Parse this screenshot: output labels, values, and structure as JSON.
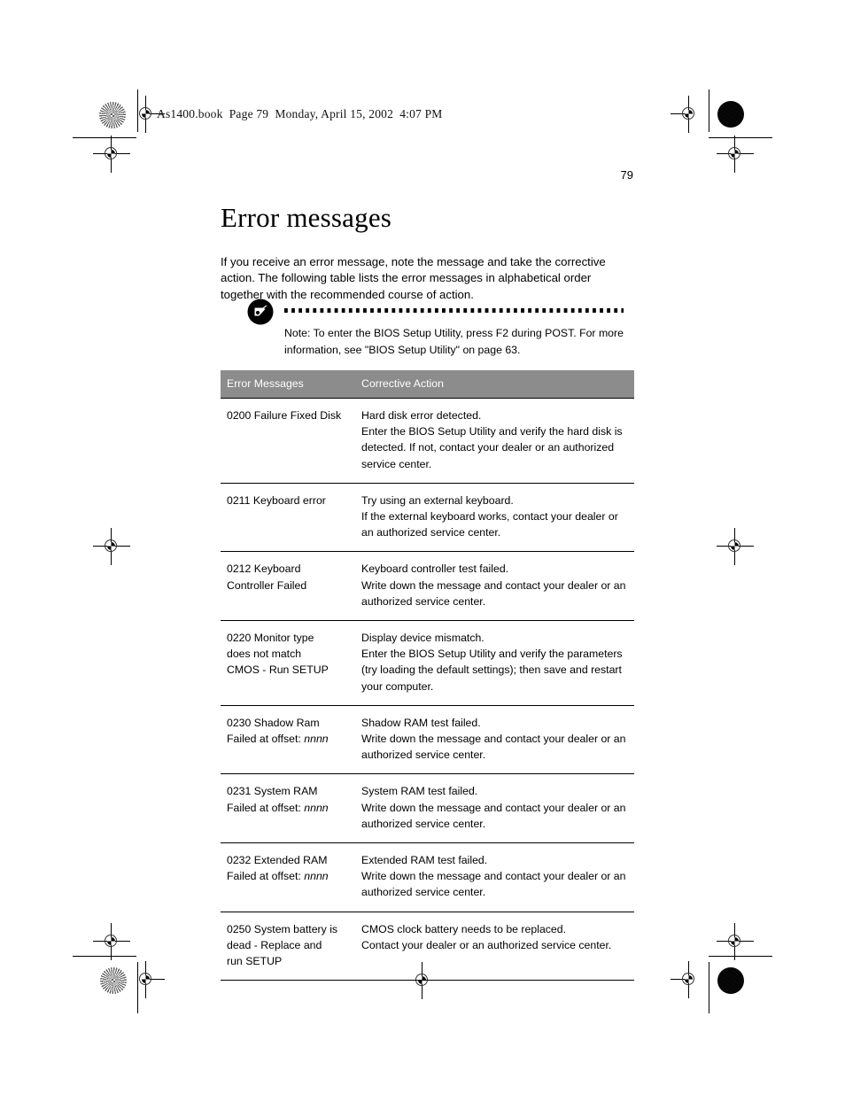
{
  "print_slug": "As1400.book  Page 79  Monday, April 15, 2002  4:07 PM",
  "page_number": "79",
  "page_title": "Error messages",
  "intro": "If you receive an error message, note the message and take the corrective action.  The following table lists the error messages in alphabetical order together with the recommended course of action.",
  "note": {
    "icon": "note-pencil-icon",
    "text": "Note:  To enter the BIOS Setup Utility, press F2 during POST.  For more information, see \"BIOS Setup Utility\" on page 63."
  },
  "table": {
    "headers": [
      "Error Messages",
      "Corrective Action"
    ],
    "rows": [
      {
        "message": "0200 Failure Fixed Disk",
        "action": "Hard disk error detected.\nEnter the BIOS Setup Utility and verify the hard disk is detected.  If not, contact your dealer or an authorized service center."
      },
      {
        "message": "0211 Keyboard error",
        "action": "Try using an external keyboard.\nIf the external keyboard works, contact your dealer or an authorized service center."
      },
      {
        "message": "0212 Keyboard\nController Failed",
        "action": "Keyboard controller test failed.\nWrite down the message and contact your dealer or an authorized service center."
      },
      {
        "message": "0220 Monitor type\ndoes not match\nCMOS - Run SETUP",
        "action": "Display device mismatch.\nEnter the BIOS Setup Utility and verify the parameters (try loading the default settings); then save and restart your computer."
      },
      {
        "message": "0230 Shadow Ram\nFailed at offset: nnnn",
        "action": "Shadow RAM test failed.\nWrite down the message and contact your dealer or an authorized service center."
      },
      {
        "message": "0231 System RAM\nFailed at offset: nnnn",
        "action": "System RAM test failed.\nWrite down the message and contact your dealer or an authorized service center."
      },
      {
        "message": "0232 Extended RAM\nFailed at offset: nnnn",
        "action": "Extended RAM test failed.\nWrite down the message and contact your dealer or an authorized service center."
      },
      {
        "message": "0250 System battery is\ndead - Replace and\nrun SETUP",
        "action": "CMOS clock battery needs to be replaced.\nContact your dealer or an authorized service center."
      }
    ]
  },
  "colors": {
    "table_header_bg": "#8c8c8c",
    "table_header_text": "#ffffff",
    "rule": "#000000",
    "page_bg": "#ffffff"
  }
}
